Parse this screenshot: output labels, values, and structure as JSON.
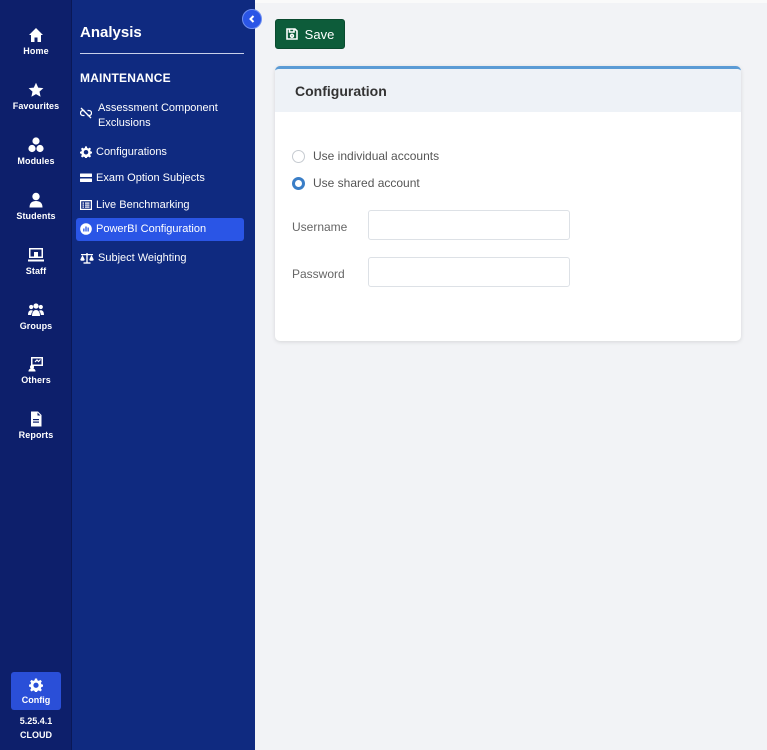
{
  "rail": {
    "items": [
      {
        "label": "Home",
        "icon": "home-icon"
      },
      {
        "label": "Favourites",
        "icon": "star-icon"
      },
      {
        "label": "Modules",
        "icon": "modules-icon"
      },
      {
        "label": "Students",
        "icon": "student-icon"
      },
      {
        "label": "Staff",
        "icon": "staff-icon"
      },
      {
        "label": "Groups",
        "icon": "groups-icon"
      },
      {
        "label": "Others",
        "icon": "others-icon"
      },
      {
        "label": "Reports",
        "icon": "report-icon"
      }
    ],
    "config_label": "Config",
    "version": "5.25.4.1",
    "edition": "CLOUD"
  },
  "sidebar": {
    "title": "Analysis",
    "section": "MAINTENANCE",
    "items": [
      {
        "label": "Assessment Component Exclusions",
        "icon": "unlink-icon"
      },
      {
        "label": "Configurations",
        "icon": "gear-icon"
      },
      {
        "label": "Exam Option Subjects",
        "icon": "list-icon"
      },
      {
        "label": "Live Benchmarking",
        "icon": "table-icon"
      },
      {
        "label": "PowerBI Configuration",
        "icon": "powerbi-icon"
      },
      {
        "label": "Subject Weighting",
        "icon": "scale-icon"
      }
    ],
    "active_index": 4
  },
  "toolbar": {
    "save_label": "Save"
  },
  "card": {
    "title": "Configuration",
    "radio_individual": "Use individual accounts",
    "radio_shared": "Use shared account",
    "selected": "shared",
    "username_label": "Username",
    "username_value": "",
    "password_label": "Password",
    "password_value": ""
  },
  "colors": {
    "rail_bg": "#0d1f6b",
    "sidebar_bg": "#0f2a80",
    "active_item": "#2a55e6",
    "save_button": "#0d5c3a",
    "card_accent": "#5b9bd5"
  }
}
